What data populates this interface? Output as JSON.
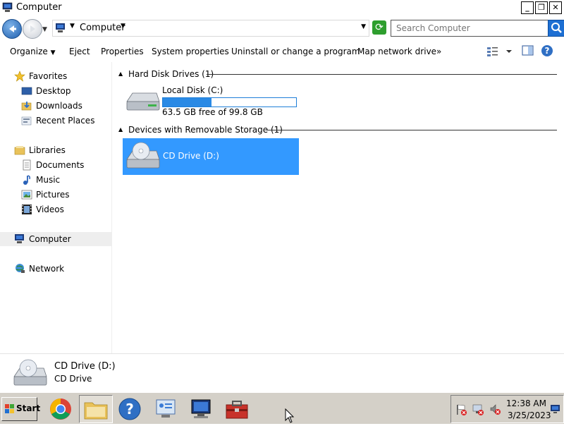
{
  "window": {
    "title": "Computer",
    "minimize": "_",
    "restore": "❐",
    "close": "✕"
  },
  "address": {
    "location": "Computer",
    "search_placeholder": "Search Computer"
  },
  "toolbar": {
    "organize": "Organize",
    "eject": "Eject",
    "properties": "Properties",
    "system_properties": "System properties",
    "uninstall": "Uninstall or change a program",
    "map_drive": "Map network drive",
    "more": "»"
  },
  "sidebar": {
    "favorites": "Favorites",
    "desktop": "Desktop",
    "downloads": "Downloads",
    "recent": "Recent Places",
    "libraries": "Libraries",
    "documents": "Documents",
    "music": "Music",
    "pictures": "Pictures",
    "videos": "Videos",
    "computer": "Computer",
    "network": "Network"
  },
  "groups": {
    "hdd": "Hard Disk Drives (1)",
    "removable": "Devices with Removable Storage (1)"
  },
  "drives": {
    "c": {
      "name": "Local Disk (C:)",
      "free_text": "63.5 GB free of 99.8 GB",
      "used_fraction": 0.364
    },
    "d": {
      "name": "CD Drive (D:)"
    }
  },
  "details": {
    "name": "CD Drive (D:)",
    "type": "CD Drive"
  },
  "taskbar": {
    "start": "Start",
    "time": "12:38 AM",
    "date": "3/25/2023"
  },
  "colors": {
    "selection": "#3399ff",
    "usage_bar": "#2a8ae5"
  }
}
